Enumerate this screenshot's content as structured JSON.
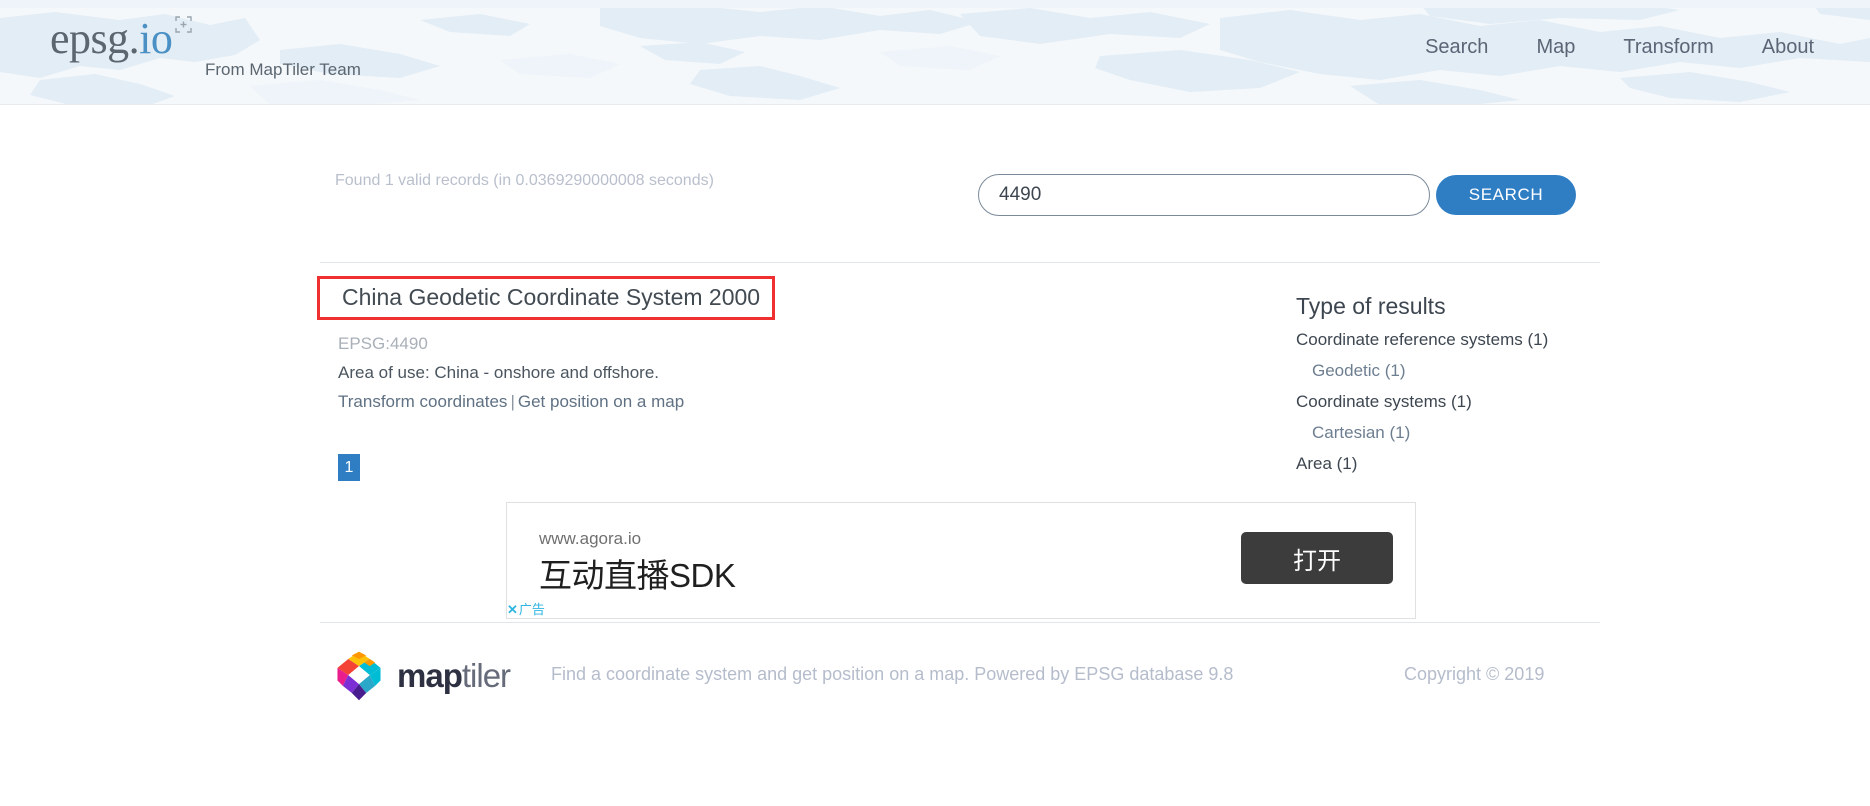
{
  "header": {
    "logo": {
      "primary": "epsg.",
      "accent": "io",
      "reticle_icon": "reticle-icon"
    },
    "tagline": "From MapTiler Team",
    "nav": [
      {
        "label": "Search"
      },
      {
        "label": "Map"
      },
      {
        "label": "Transform"
      },
      {
        "label": "About"
      }
    ]
  },
  "search": {
    "found_text": "Found 1 valid records (in 0.0369290000008 seconds)",
    "input_value": "4490",
    "input_placeholder": "",
    "button_label": "SEARCH"
  },
  "results": [
    {
      "title": "China Geodetic Coordinate System 2000",
      "epsg": "EPSG:4490",
      "area": "Area of use: China - onshore and offshore.",
      "link_transform": "Transform coordinates",
      "link_separator": "|",
      "link_map": "Get position on a map",
      "highlight_color": "#f03030"
    }
  ],
  "pagination": {
    "current": "1"
  },
  "sidebar": {
    "title": "Type of results",
    "items": [
      {
        "label": "Coordinate reference systems (1)",
        "sub": false
      },
      {
        "label": "Geodetic (1)",
        "sub": true
      },
      {
        "label": "Coordinate systems (1)",
        "sub": false
      },
      {
        "label": "Cartesian (1)",
        "sub": true
      },
      {
        "label": "Area (1)",
        "sub": false
      }
    ]
  },
  "ad": {
    "url": "www.agora.io",
    "headline": "互动直播SDK",
    "badge_x": "✕",
    "badge_label": "广告",
    "button_label": "打开"
  },
  "footer": {
    "brand_bold": "map",
    "brand_light": "tiler",
    "tagline": "Find a coordinate system and get position on a map. Powered by EPSG database 9.8",
    "copyright": "Copyright © 2019"
  },
  "colors": {
    "accent_blue": "#2f7ec4",
    "logo_blue": "#4a90c4",
    "highlight_red": "#f03030",
    "ad_button_dark": "#3c3c3c",
    "ad_badge_cyan": "#2fb5e0"
  }
}
